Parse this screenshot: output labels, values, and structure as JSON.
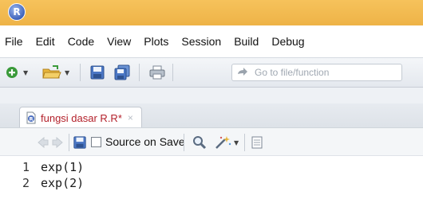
{
  "window": {
    "logo_letter": "R"
  },
  "menu": {
    "items": [
      "File",
      "Edit",
      "Code",
      "View",
      "Plots",
      "Session",
      "Build",
      "Debug"
    ]
  },
  "toolbar": {
    "goto_placeholder": "Go to file/function"
  },
  "editor_tab": {
    "label": "fungsi dasar R.R*",
    "close": "×"
  },
  "editor_toolbar": {
    "source_on_save_label": "Source on Save",
    "source_on_save_checked": false
  },
  "editor": {
    "lines": [
      {
        "number": "1",
        "code": "exp(1)"
      },
      {
        "number": "2",
        "code": "exp(2)"
      }
    ]
  },
  "colors": {
    "title_bar": "#f0b94f",
    "tab_label": "#b3202a"
  }
}
